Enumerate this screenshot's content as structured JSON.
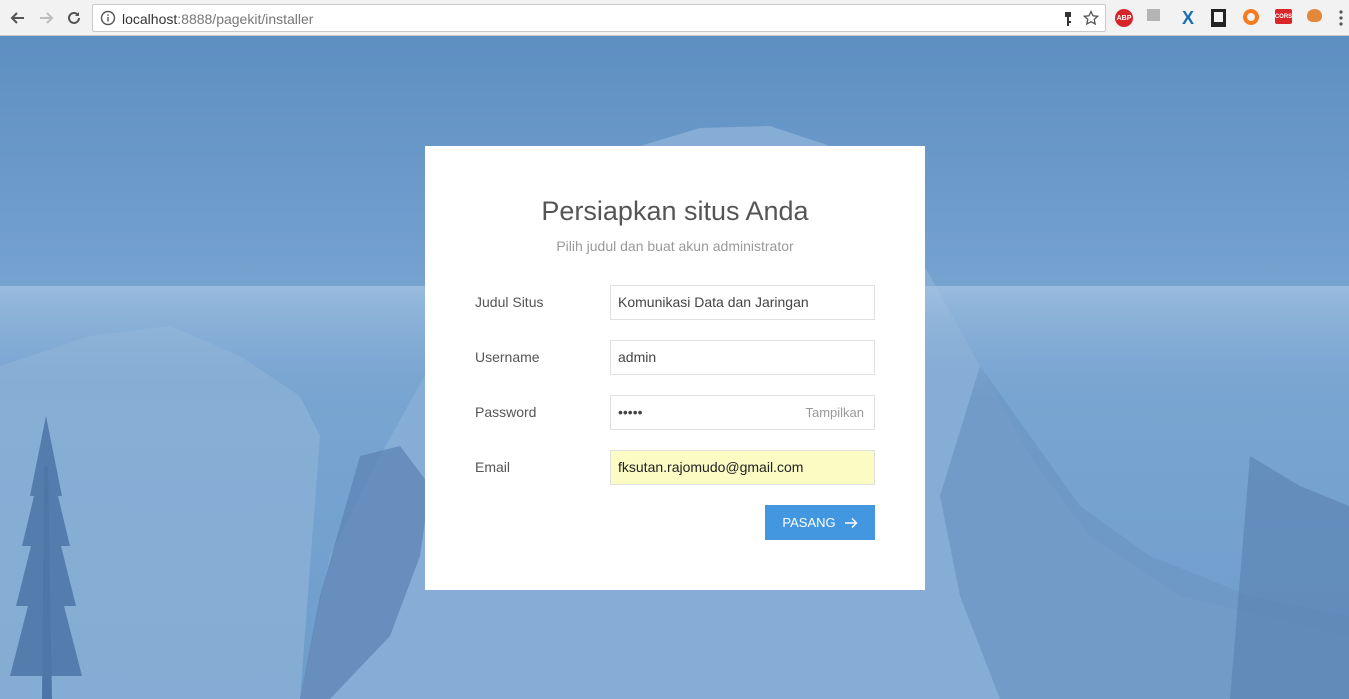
{
  "browser": {
    "url_host": "localhost",
    "url_path": ":8888/pagekit/installer",
    "extensions": [
      {
        "name": "adblock-plus-icon",
        "label": "ABP",
        "color": "#d6252a"
      },
      {
        "name": "extension-grey-icon",
        "label": "",
        "color": "#9a9a9a"
      },
      {
        "name": "x-extension-icon",
        "label": "X",
        "color": "#1b6fb5"
      },
      {
        "name": "bookmark-extension-icon",
        "label": "",
        "color": "#222222"
      },
      {
        "name": "orange-ring-extension-icon",
        "label": "",
        "color": "#f47b20"
      },
      {
        "name": "cors-extension-icon",
        "label": "CORS",
        "color": "#d9262b"
      },
      {
        "name": "fox-extension-icon",
        "label": "",
        "color": "#e3883a"
      }
    ]
  },
  "installer": {
    "title": "Persiapkan situs Anda",
    "subtitle": "Pilih judul dan buat akun administrator",
    "fields": [
      {
        "label": "Judul Situs",
        "value": "Komunikasi Data dan Jaringan"
      },
      {
        "label": "Username",
        "value": "admin"
      },
      {
        "label": "Password",
        "value": "•••••",
        "toggle": "Tampilkan"
      },
      {
        "label": "Email",
        "value": "fksutan.rajomudo@gmail.com"
      }
    ],
    "install_label": "PASANG"
  },
  "colors": {
    "accent": "#4397e0",
    "autofill": "#fbfcc4",
    "background": "#6f9ccb"
  }
}
